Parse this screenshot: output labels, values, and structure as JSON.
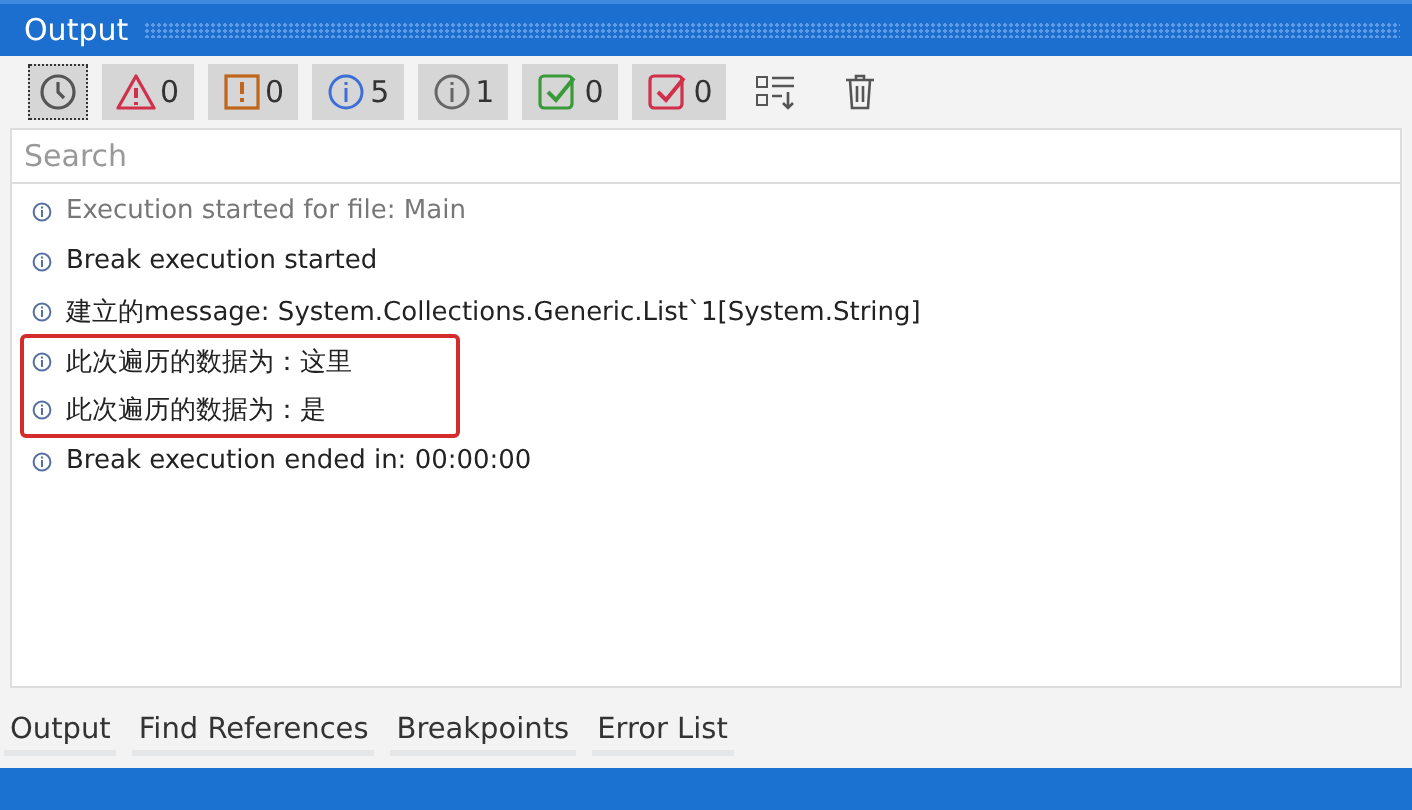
{
  "window": {
    "title": "Output"
  },
  "toolbar": {
    "filters": [
      {
        "kind": "time",
        "selected": true
      },
      {
        "kind": "error",
        "count": "0",
        "selected": true
      },
      {
        "kind": "warning",
        "count": "0",
        "selected": true
      },
      {
        "kind": "info",
        "count": "5",
        "selected": true
      },
      {
        "kind": "trace",
        "count": "1",
        "selected": true
      },
      {
        "kind": "passed",
        "count": "0",
        "selected": true
      },
      {
        "kind": "failed",
        "count": "0",
        "selected": true
      },
      {
        "kind": "sort",
        "selected": false
      },
      {
        "kind": "clear",
        "selected": false
      }
    ]
  },
  "search": {
    "placeholder": "Search"
  },
  "log": [
    {
      "text": "Execution started for file: Main",
      "dimmed": true,
      "highlighted": false
    },
    {
      "text": "Break execution started",
      "dimmed": false,
      "highlighted": false
    },
    {
      "text": "建立的message: System.Collections.Generic.List`1[System.String]",
      "dimmed": false,
      "highlighted": false
    },
    {
      "text": "此次遍历的数据为：这里",
      "dimmed": false,
      "highlighted": true
    },
    {
      "text": "此次遍历的数据为：是",
      "dimmed": false,
      "highlighted": true
    },
    {
      "text": "Break execution ended in: 00:00:00",
      "dimmed": false,
      "highlighted": false
    }
  ],
  "tabs": [
    {
      "label": "Output"
    },
    {
      "label": "Find References"
    },
    {
      "label": "Breakpoints"
    },
    {
      "label": "Error List"
    }
  ]
}
